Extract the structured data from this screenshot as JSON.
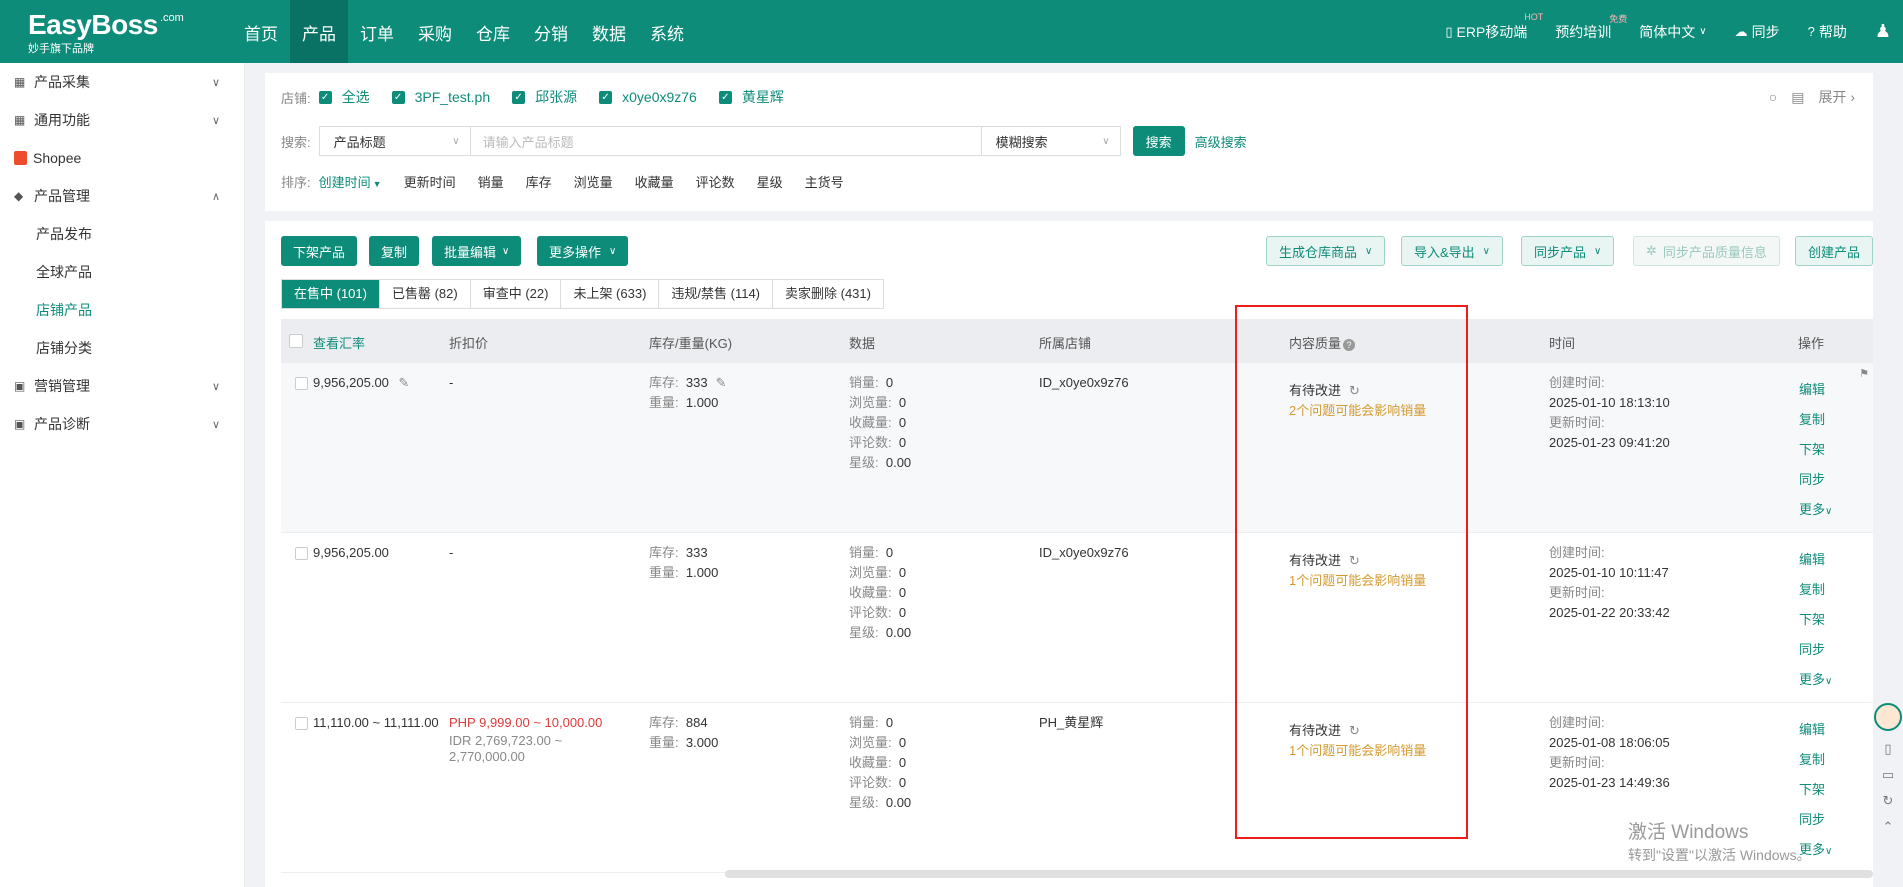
{
  "topbar": {
    "logo": "EasyBoss",
    "logo_com": ".com",
    "logo_sub": "妙手旗下品牌",
    "nav": [
      "首页",
      "产品",
      "订单",
      "采购",
      "仓库",
      "分销",
      "数据",
      "系统"
    ],
    "right": {
      "erp": "ERP移动端",
      "erp_badge": "HOT",
      "training": "预约培训",
      "training_badge": "免费",
      "lang": "简体中文",
      "sync": "同步",
      "help": "帮助"
    }
  },
  "sidebar": {
    "collect": "产品采集",
    "common": "通用功能",
    "shopee": "Shopee",
    "manage": "产品管理",
    "sub": [
      "产品发布",
      "全球产品",
      "店铺产品",
      "店铺分类"
    ],
    "marketing": "营销管理",
    "diagnose": "产品诊断"
  },
  "filter": {
    "store_label": "店铺:",
    "stores": [
      "全选",
      "3PF_test.ph",
      "邱张源",
      "x0ye0x9z76",
      "黄星辉"
    ],
    "search_label": "搜索:",
    "search_field": "产品标题",
    "search_placeholder": "请输入产品标题",
    "search_mode": "模糊搜索",
    "search_btn": "搜索",
    "advanced": "高级搜索",
    "sort_label": "排序:",
    "sort": [
      "创建时间",
      "更新时间",
      "销量",
      "库存",
      "浏览量",
      "收藏量",
      "评论数",
      "星级",
      "主货号"
    ],
    "expand": "展开"
  },
  "actions": {
    "left": [
      "下架产品",
      "复制",
      "批量编辑",
      "更多操作"
    ],
    "right": [
      "生成仓库商品",
      "导入&导出",
      "同步产品",
      "同步产品质量信息",
      "创建产品"
    ]
  },
  "tabs": [
    "在售中 (101)",
    "已售罄 (82)",
    "审查中 (22)",
    "未上架 (633)",
    "违规/禁售 (114)",
    "卖家删除 (431)"
  ],
  "table": {
    "headers": [
      "查看汇率",
      "折扣价",
      "库存/重量(KG)",
      "数据",
      "所属店铺",
      "内容质量",
      "时间",
      "操作"
    ],
    "stock_label": "库存:",
    "weight_label": "重量:",
    "data_labels": [
      "销量:",
      "浏览量:",
      "收藏量:",
      "评论数:",
      "星级:"
    ],
    "created_label": "创建时间:",
    "updated_label": "更新时间:",
    "ops": [
      "编辑",
      "复制",
      "下架",
      "同步",
      "更多"
    ],
    "rows": [
      {
        "price": "9,956,205.00",
        "discount": "-",
        "discount2": "",
        "stock": "333",
        "weight": "1.000",
        "sales": "0",
        "views": "0",
        "favs": "0",
        "reviews": "0",
        "stars": "0.00",
        "store": "ID_x0ye0x9z76",
        "quality": "有待改进",
        "quality_note": "2个问题可能会影响销量",
        "created": "2025-01-10 18:13:10",
        "updated": "2025-01-23 09:41:20"
      },
      {
        "price": "9,956,205.00",
        "discount": "-",
        "discount2": "",
        "stock": "333",
        "weight": "1.000",
        "sales": "0",
        "views": "0",
        "favs": "0",
        "reviews": "0",
        "stars": "0.00",
        "store": "ID_x0ye0x9z76",
        "quality": "有待改进",
        "quality_note": "1个问题可能会影响销量",
        "created": "2025-01-10 10:11:47",
        "updated": "2025-01-22 20:33:42"
      },
      {
        "price": "11,110.00 ~ 11,111.00",
        "discount": "PHP 9,999.00 ~ 10,000.00",
        "discount2": "IDR 2,769,723.00 ~ 2,770,000.00",
        "stock": "884",
        "weight": "3.000",
        "sales": "0",
        "views": "0",
        "favs": "0",
        "reviews": "0",
        "stars": "0.00",
        "store": "PH_黄星辉",
        "quality": "有待改进",
        "quality_note": "1个问题可能会影响销量",
        "created": "2025-01-08 18:06:05",
        "updated": "2025-01-23 14:49:36"
      }
    ]
  },
  "watermark": {
    "line1": "激活 Windows",
    "line2": "转到\"设置\"以激活 Windows。"
  }
}
